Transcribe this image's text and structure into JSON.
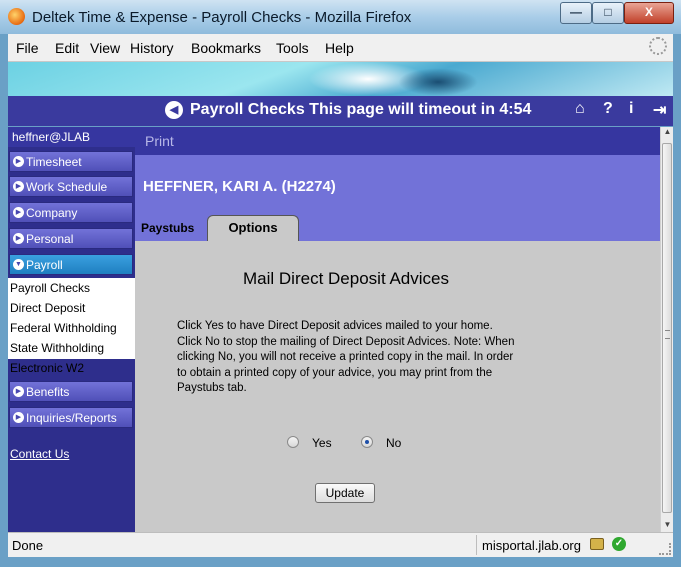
{
  "window": {
    "title": "Deltek Time & Expense - Payroll Checks - Mozilla Firefox",
    "min_label": "—",
    "max_label": "□",
    "close_label": "X"
  },
  "menu": [
    "File",
    "Edit",
    "View",
    "History",
    "Bookmarks",
    "Tools",
    "Help"
  ],
  "header": {
    "title": "Payroll Checks  This page will timeout in 4:54",
    "icons": [
      "home-icon",
      "help-icon",
      "info-icon",
      "logout-icon"
    ],
    "icon_glyphs": [
      "⌂",
      "?",
      "i",
      "⇥"
    ]
  },
  "sidebar": {
    "user": "heffner@JLAB",
    "items_top": [
      "Timesheet",
      "Work Schedule",
      "Company",
      "Personal"
    ],
    "selected": "Payroll",
    "sub_items": [
      "Payroll Checks",
      "Direct Deposit",
      "Federal Withholding",
      "State Withholding",
      "Electronic W2"
    ],
    "items_bottom": [
      "Benefits",
      "Inquiries/Reports"
    ],
    "contact": "Contact Us"
  },
  "main": {
    "print": "Print",
    "employee": "HEFFNER, KARI A. (H2274)",
    "tabs": [
      "Paystubs",
      "Options"
    ],
    "active_tab": "Options",
    "heading": "Mail Direct Deposit Advices",
    "paragraph": "Click Yes to have Direct Deposit advices mailed to your home. Click No to stop the mailing of Direct Deposit Advices. Note: When clicking No, you will not receive a printed copy in the mail. In order to obtain a printed copy of your advice, you may print from the Paystubs tab.",
    "options": [
      "Yes",
      "No"
    ],
    "selected_option": "No",
    "button": "Update"
  },
  "status": {
    "text": "Done",
    "host": "misportal.jlab.org"
  },
  "colors": {
    "header": "#3a3a9e",
    "namebar": "#7272d8",
    "selected_nav": "#1f7fc0"
  }
}
